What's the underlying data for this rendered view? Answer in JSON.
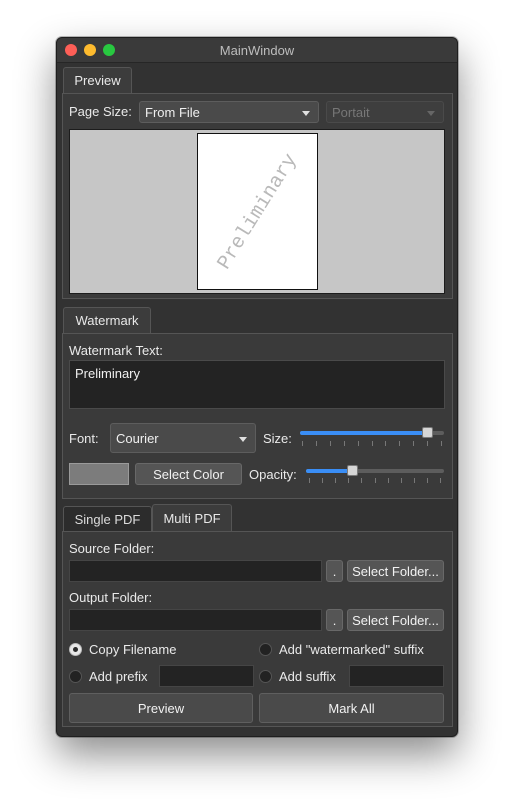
{
  "window": {
    "title": "MainWindow"
  },
  "preview_section": {
    "tab_label": "Preview",
    "page_size_label": "Page Size:",
    "page_size_value": "From File",
    "orientation_value": "Portait",
    "watermark_preview_text": "Preliminary"
  },
  "watermark_section": {
    "tab_label": "Watermark",
    "text_label": "Watermark Text:",
    "text_value": "Preliminary",
    "font_label": "Font:",
    "font_value": "Courier",
    "size_label": "Size:",
    "size_level": 0.92,
    "select_color_label": "Select Color",
    "opacity_label": "Opacity:",
    "opacity_level": 0.32,
    "swatch_color": "#7c7c7c"
  },
  "output_section": {
    "tabs": [
      {
        "label": "Single PDF"
      },
      {
        "label": "Multi PDF"
      }
    ],
    "source_folder_label": "Source Folder:",
    "dot_label": ".",
    "select_folder_label": "Select Folder...",
    "output_folder_label": "Output Folder:",
    "options": {
      "copy_filename": "Copy Filename",
      "add_watermarked_suffix": "Add \"watermarked\" suffix",
      "add_prefix": "Add prefix",
      "add_suffix": "Add suffix"
    },
    "preview_button": "Preview",
    "mark_all_button": "Mark All"
  },
  "colors": {
    "accent": "#3a8ef6",
    "window_bg": "#323232",
    "close": "#fe5f57",
    "minimize": "#febb2e",
    "maximize": "#28c840"
  }
}
